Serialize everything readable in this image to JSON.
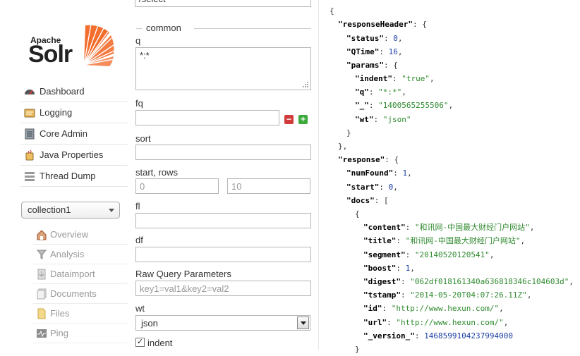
{
  "sidebar": {
    "logo": {
      "apache": "Apache",
      "name": "Solr"
    },
    "nav": [
      {
        "label": "Dashboard",
        "icon": "dashboard-icon"
      },
      {
        "label": "Logging",
        "icon": "logging-icon"
      },
      {
        "label": "Core Admin",
        "icon": "core-admin-icon"
      },
      {
        "label": "Java Properties",
        "icon": "java-properties-icon"
      },
      {
        "label": "Thread Dump",
        "icon": "thread-dump-icon"
      }
    ],
    "core_selector": {
      "value": "collection1"
    },
    "core_menu": [
      {
        "label": "Overview",
        "icon": "overview-icon"
      },
      {
        "label": "Analysis",
        "icon": "analysis-icon"
      },
      {
        "label": "Dataimport",
        "icon": "dataimport-icon"
      },
      {
        "label": "Documents",
        "icon": "documents-icon"
      },
      {
        "label": "Files",
        "icon": "files-icon"
      },
      {
        "label": "Ping",
        "icon": "ping-icon"
      }
    ]
  },
  "form": {
    "request_handler": "/select",
    "common_label": "common",
    "q": {
      "label": "q",
      "value": "*:*"
    },
    "fq": {
      "label": "fq",
      "value": ""
    },
    "sort": {
      "label": "sort",
      "value": ""
    },
    "start_rows": {
      "label": "start, rows",
      "start_placeholder": "0",
      "rows_placeholder": "10"
    },
    "fl": {
      "label": "fl",
      "value": ""
    },
    "df": {
      "label": "df",
      "value": ""
    },
    "raw": {
      "label": "Raw Query Parameters",
      "placeholder": "key1=val1&key2=val2"
    },
    "wt": {
      "label": "wt",
      "value": "json"
    },
    "indent": {
      "label": "indent",
      "checked": true
    }
  },
  "response": {
    "open_brace": "{",
    "responseHeader": {
      "key": "\"responseHeader\"",
      "status": {
        "key": "\"status\"",
        "value": "0"
      },
      "qtime": {
        "key": "\"QTime\"",
        "value": "16"
      },
      "params": {
        "key": "\"params\"",
        "indent": {
          "key": "\"indent\"",
          "value": "\"true\""
        },
        "q": {
          "key": "\"q\"",
          "value": "\"*:*\""
        },
        "underscore": {
          "key": "\"_\"",
          "value": "\"1400565255506\""
        },
        "wt": {
          "key": "\"wt\"",
          "value": "\"json\""
        }
      }
    },
    "response": {
      "key": "\"response\"",
      "numFound": {
        "key": "\"numFound\"",
        "value": "1"
      },
      "start": {
        "key": "\"start\"",
        "value": "0"
      },
      "docs": {
        "key": "\"docs\""
      },
      "doc": {
        "content": {
          "key": "\"content\"",
          "value": "\"和讯网-中国最大财经门户网站\""
        },
        "title": {
          "key": "\"title\"",
          "value": "\"和讯网-中国最大财经门户网站\""
        },
        "segment": {
          "key": "\"segment\"",
          "value": "\"20140520120541\""
        },
        "boost": {
          "key": "\"boost\"",
          "value": "1"
        },
        "digest": {
          "key": "\"digest\"",
          "value": "\"062df018161340a636818346c104603d\""
        },
        "tstamp": {
          "key": "\"tstamp\"",
          "value": "\"2014-05-20T04:07:26.11Z\""
        },
        "id": {
          "key": "\"id\"",
          "value": "\"http://www.hexun.com/\""
        },
        "url": {
          "key": "\"url\"",
          "value": "\"http://www.hexun.com/\""
        },
        "version": {
          "key": "\"_version_\"",
          "value": "1468599104237994000"
        }
      }
    }
  },
  "colors": {
    "json_string": "#2f8a2f",
    "json_number": "#1a3fa3",
    "logo_orange": "#f26522"
  }
}
